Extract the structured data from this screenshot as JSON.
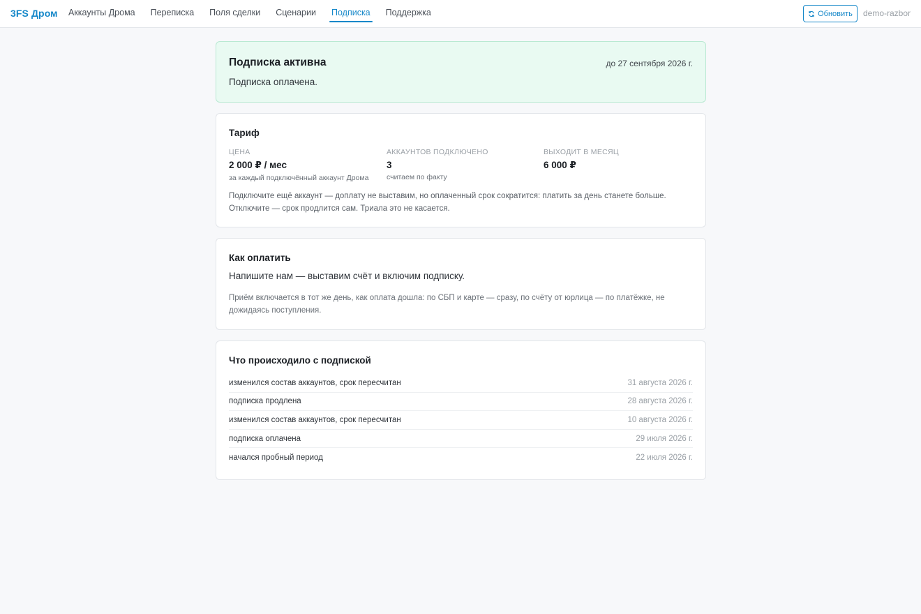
{
  "header": {
    "brand": "3FS Дром",
    "nav": [
      {
        "label": "Аккаунты Дрома",
        "active": false
      },
      {
        "label": "Переписка",
        "active": false
      },
      {
        "label": "Поля сделки",
        "active": false
      },
      {
        "label": "Сценарии",
        "active": false
      },
      {
        "label": "Подписка",
        "active": true
      },
      {
        "label": "Поддержка",
        "active": false
      }
    ],
    "refresh_label": "Обновить",
    "refresh_icon": "refresh-icon",
    "user": "demo-razbor",
    "accent_color": "#1688c9"
  },
  "status": {
    "title": "Подписка активна",
    "until": "до 27 сентября 2026 г.",
    "text": "Подписка оплачена.",
    "color": "#e9faf2"
  },
  "tariff": {
    "title": "Тариф",
    "price": {
      "label": "Цена",
      "value": "2 000 ₽ / мес",
      "note": "за каждый подключённый аккаунт Дрома"
    },
    "accounts": {
      "label": "Аккаунтов подключено",
      "value": "3",
      "note": "считаем по факту"
    },
    "monthly": {
      "label": "Выходит в месяц",
      "value": "6 000 ₽"
    },
    "note_line1": "Подключите ещё аккаунт — доплату не выставим, но оплаченный срок сократится: платить за день станете больше.",
    "note_line2": "Отключите — срок продлится сам. Триала это не касается."
  },
  "howpay": {
    "title": "Как оплатить",
    "lead": "Напишите нам — выставим счёт и включим подписку.",
    "note_line1": "Приём включается в тот же день, как оплата дошла: по СБП и карте — сразу, по счёту от юрлица — по платёжке, не",
    "note_line2": "дожидаясь поступления."
  },
  "history": {
    "title": "Что происходило с подпиской",
    "rows": [
      {
        "event": "изменился состав аккаунтов, срок пересчитан",
        "date": "31 августа 2026 г."
      },
      {
        "event": "подписка продлена",
        "date": "28 августа 2026 г."
      },
      {
        "event": "изменился состав аккаунтов, срок пересчитан",
        "date": "10 августа 2026 г."
      },
      {
        "event": "подписка оплачена",
        "date": "29 июля 2026 г."
      },
      {
        "event": "начался пробный период",
        "date": "22 июля 2026 г."
      }
    ]
  }
}
